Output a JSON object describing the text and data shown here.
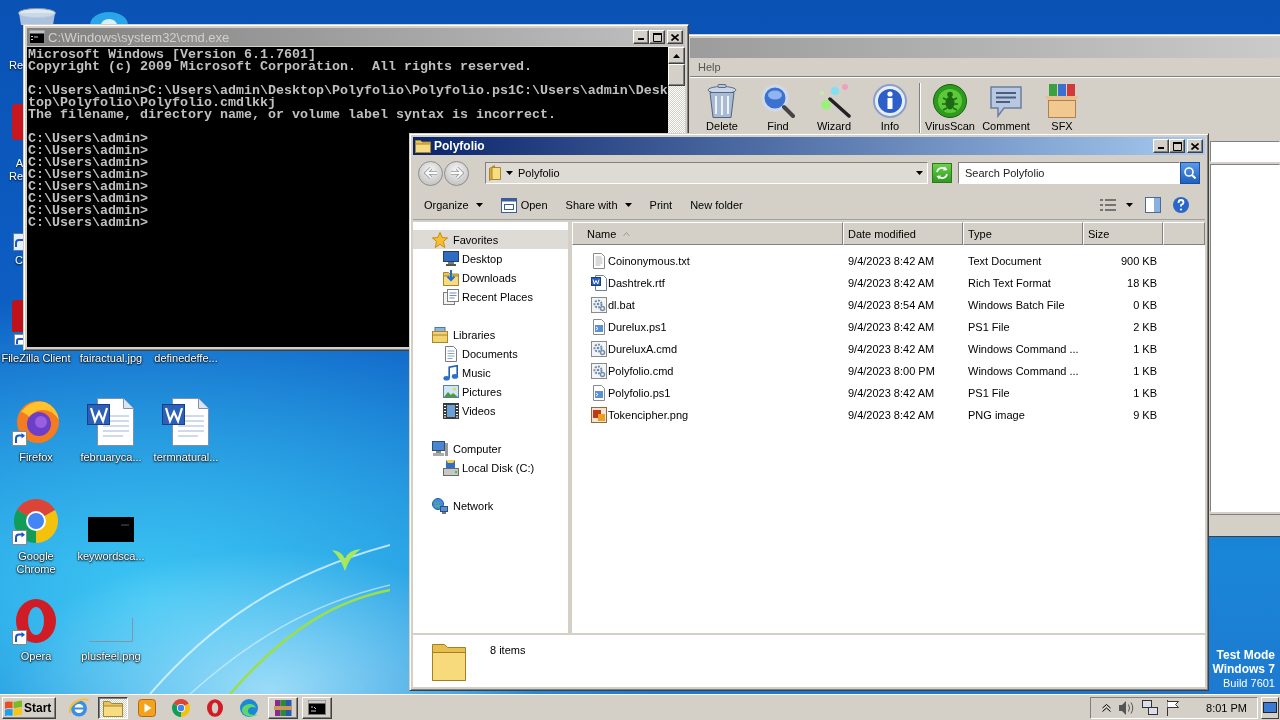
{
  "desktop": {
    "icons": [
      {
        "label": "Re"
      },
      {
        "label": "A Re"
      },
      {
        "label": "C"
      },
      {
        "label": "FileZilla Client"
      },
      {
        "label": "fairactual.jpg"
      },
      {
        "label": "definedeffe..."
      },
      {
        "label": "Firefox"
      },
      {
        "label": "februaryca..."
      },
      {
        "label": "termnatural..."
      },
      {
        "label": "Google Chrome"
      },
      {
        "label": "keywordsca..."
      },
      {
        "label": "Opera"
      },
      {
        "label": "plusfeel.png"
      }
    ]
  },
  "archiver_window": {
    "menu": [
      "Help"
    ],
    "toolbar_groups": [
      [
        "Delete",
        "Find",
        "Wizard",
        "Info"
      ],
      [
        "VirusScan",
        "Comment",
        "SFX"
      ]
    ]
  },
  "console_window": {
    "title": "C:\\Windows\\system32\\cmd.exe",
    "blocks": [
      [
        "Microsoft Windows [Version 6.1.7601]",
        "Copyright (c) 2009 Microsoft Corporation.  All rights reserved."
      ],
      [
        "C:\\Users\\admin>C:\\Users\\admin\\Desktop\\Polyfolio\\Polyfolio.ps1C:\\Users\\admin\\Desktop\\Polyfolio\\Polyfolio.cmdlkkj",
        "The filename, directory name, or volume label syntax is incorrect."
      ],
      [
        "C:\\Users\\admin>",
        "C:\\Users\\admin>",
        "C:\\Users\\admin>",
        "C:\\Users\\admin>",
        "C:\\Users\\admin>",
        "C:\\Users\\admin>",
        "C:\\Users\\admin>",
        "C:\\Users\\admin>"
      ]
    ]
  },
  "explorer_window": {
    "title": "Polyfolio",
    "breadcrumb": [
      "Polyfolio"
    ],
    "search": {
      "placeholder": "Search Polyfolio"
    },
    "toolbar": [
      {
        "label": "Organize",
        "kind": "menu"
      },
      {
        "label": "Open",
        "kind": "icon"
      },
      {
        "label": "Share with",
        "kind": "menu"
      },
      {
        "label": "Print",
        "kind": "plain"
      },
      {
        "label": "New folder",
        "kind": "plain"
      }
    ],
    "navigation": [
      {
        "label": "Favorites",
        "selected": true,
        "children": [
          {
            "label": "Desktop",
            "selected": false
          },
          {
            "label": "Downloads",
            "selected": false
          },
          {
            "label": "Recent Places",
            "selected": false
          }
        ]
      },
      {
        "label": "Libraries",
        "selected": false,
        "children": [
          {
            "label": "Documents",
            "selected": false
          },
          {
            "label": "Music",
            "selected": false
          },
          {
            "label": "Pictures",
            "selected": false
          },
          {
            "label": "Videos",
            "selected": false
          }
        ]
      },
      {
        "label": "Computer",
        "selected": false,
        "children": [
          {
            "label": "Local Disk (C:)",
            "selected": false
          }
        ]
      },
      {
        "label": "Network",
        "selected": false
      }
    ],
    "columns": [
      {
        "label": "Name",
        "sorted": true
      },
      {
        "label": "Date modified",
        "sorted": false
      },
      {
        "label": "Type",
        "sorted": false
      },
      {
        "label": "Size",
        "sorted": false
      }
    ],
    "files": [
      {
        "name": "Coinonymous.txt",
        "date": "9/4/2023 8:42 AM",
        "type": "Text Document",
        "size": "900 KB",
        "kind": "text"
      },
      {
        "name": "Dashtrek.rtf",
        "date": "9/4/2023 8:42 AM",
        "type": "Rich Text Format",
        "size": "18 KB",
        "kind": "document"
      },
      {
        "name": "dl.bat",
        "date": "9/4/2023 8:54 AM",
        "type": "Windows Batch File",
        "size": "0 KB",
        "kind": "batch"
      },
      {
        "name": "Durelux.ps1",
        "date": "9/4/2023 8:42 AM",
        "type": "PS1 File",
        "size": "2 KB",
        "kind": "script"
      },
      {
        "name": "DureluxA.cmd",
        "date": "9/4/2023 8:42 AM",
        "type": "Windows Command ...",
        "size": "1 KB",
        "kind": "batch"
      },
      {
        "name": "Polyfolio.cmd",
        "date": "9/4/2023 8:00 PM",
        "type": "Windows Command ...",
        "size": "1 KB",
        "kind": "batch"
      },
      {
        "name": "Polyfolio.ps1",
        "date": "9/4/2023 8:42 AM",
        "type": "PS1 File",
        "size": "1 KB",
        "kind": "script"
      },
      {
        "name": "Tokencipher.png",
        "date": "9/4/2023 8:42 AM",
        "type": "PNG image",
        "size": "9 KB",
        "kind": "image"
      }
    ],
    "status": "8 items"
  },
  "system_notice": {
    "lines": [
      "Test Mode",
      "Windows 7",
      "Build 7601"
    ]
  },
  "taskbar": {
    "start": "Start",
    "buttons": [
      {
        "kind": "pinned",
        "selected": false
      },
      {
        "kind": "window",
        "selected": true
      },
      {
        "kind": "pinned",
        "selected": false
      },
      {
        "kind": "pinned",
        "selected": false
      },
      {
        "kind": "pinned",
        "selected": false
      },
      {
        "kind": "pinned",
        "selected": false
      },
      {
        "kind": "window",
        "selected": false
      },
      {
        "kind": "window",
        "selected": false
      }
    ],
    "clock": "8:01 PM"
  }
}
